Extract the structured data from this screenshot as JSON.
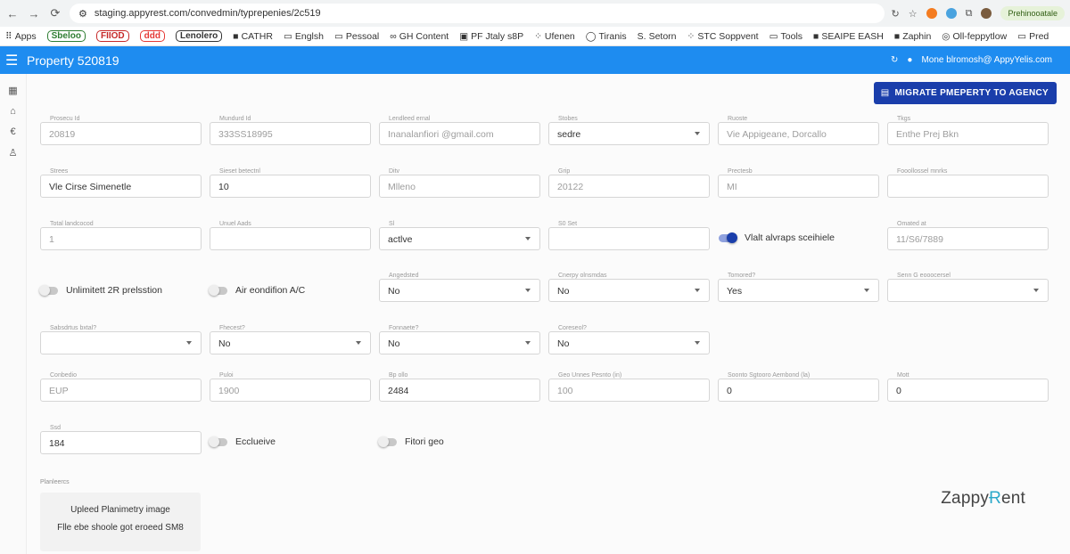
{
  "browser": {
    "url": "staging.appyrest.com/convedmin/typrepenies/2c519",
    "profile": "Prehinooatale",
    "bookmarks": [
      {
        "label": "Apps",
        "icon": "apps-grid-icon"
      },
      {
        "label": "Sbeloo",
        "chip": "#2e7d32"
      },
      {
        "label": "FIIOD",
        "chip": "#c62828"
      },
      {
        "label": "ddd",
        "chip": "#e53935"
      },
      {
        "label": "Lenolero",
        "chip": "#333333"
      },
      {
        "label": "CATHR",
        "icon": "square-icon"
      },
      {
        "label": "Englsh",
        "icon": "folder-icon"
      },
      {
        "label": "Pessoal",
        "icon": "folder-icon"
      },
      {
        "label": "GH Content",
        "icon": "link-icon"
      },
      {
        "label": "PF Jtaly s8P",
        "icon": "doc-icon"
      },
      {
        "label": "Ufenen",
        "icon": "dots-icon"
      },
      {
        "label": "Tiranis",
        "icon": "circle-icon"
      },
      {
        "label": "Setorn",
        "icon": "s-icon"
      },
      {
        "label": "STC Soppvent",
        "icon": "dots-icon"
      },
      {
        "label": "Tools",
        "icon": "folder-icon"
      },
      {
        "label": "SEAIPE EASH",
        "icon": "square-icon"
      },
      {
        "label": "Zaphin",
        "icon": "square-icon"
      },
      {
        "label": "Oll-feppytlow",
        "icon": "globe-icon"
      },
      {
        "label": "Pred",
        "icon": "folder-icon"
      }
    ]
  },
  "app": {
    "title": "Property 520819",
    "user": "Mone blromosh@ AppyYelis.com",
    "migrate_label": "MIGRATE PMEPERTY TO AGENCY"
  },
  "fields": [
    {
      "label": "Prosecu Id",
      "value": "20819",
      "muted": true
    },
    {
      "label": "Mundurd Id",
      "value": "333SS18995",
      "muted": true
    },
    {
      "label": "Lendleed ernal",
      "value": "Inanalanfiori @gmail.com",
      "muted": true
    },
    {
      "label": "Stobes",
      "value": "sedre",
      "select": true
    },
    {
      "label": "Ruoste",
      "value": "Vie Appigeane, Dorcallo",
      "muted": true
    },
    {
      "label": "Tkgs",
      "value": "Enthe Prej Bkn",
      "muted": true
    },
    {
      "label": "Strees",
      "value": "Vle Cirse Simenetle"
    },
    {
      "label": "Sieset betectnl",
      "value": "10"
    },
    {
      "label": "Ditv",
      "value": "Mlleno",
      "muted": true
    },
    {
      "label": "Grip",
      "value": "20122",
      "muted": true
    },
    {
      "label": "Prectesb",
      "value": "MI",
      "muted": true
    },
    {
      "label": "Fooollossel mnrks",
      "value": ""
    },
    {
      "label": "Total landcocod",
      "value": "1",
      "muted": true
    },
    {
      "label": "Unuel Aads",
      "value": ""
    },
    {
      "label": "Sl",
      "value": "actlve",
      "select": true
    },
    {
      "label": "S0 Set",
      "value": ""
    },
    {
      "label": "Omated at",
      "value": "11/S6/7889",
      "muted": true
    },
    {
      "label": "Angedsted",
      "value": "No",
      "select": true
    },
    {
      "label": "Cnerpy olnsmdas",
      "value": "No",
      "select": true
    },
    {
      "label": "Tomored?",
      "value": "Yes",
      "select": true
    },
    {
      "label": "Senn G eooocersel",
      "value": "",
      "select": true
    },
    {
      "label": "Sabsdrtus bxtal?",
      "value": "",
      "select": true
    },
    {
      "label": "Fhecest?",
      "value": "No",
      "select": true
    },
    {
      "label": "Fonnaete?",
      "value": "No",
      "select": true
    },
    {
      "label": "Coreseol?",
      "value": "No",
      "select": true
    },
    {
      "label": "Conbedio",
      "value": "EUP",
      "muted": true
    },
    {
      "label": "Puloi",
      "value": "1900",
      "muted": true
    },
    {
      "label": "Bp ollo",
      "value": "2484"
    },
    {
      "label": "Geo Unnes Pesnto (in)",
      "value": "100",
      "muted": true
    },
    {
      "label": "Soonto Sgtooro Aembond (la)",
      "value": "0"
    },
    {
      "label": "Mott",
      "value": "0"
    },
    {
      "label": "Ssd",
      "value": "184"
    }
  ],
  "toggles": [
    {
      "label": "Vlalt alvraps sceihiele",
      "on": true
    },
    {
      "label": "Unlimitett 2R prelsstion",
      "on": false
    },
    {
      "label": "Air eondifion A/C",
      "on": false
    },
    {
      "label": "Ecclueive",
      "on": false
    },
    {
      "label": "Fitori geo",
      "on": false
    }
  ],
  "planimetry": {
    "title": "Planleercs",
    "upload_title": "Upleed Planimetry image",
    "upload_note": "Flle ebe shoole got eroeed SM8"
  },
  "brand": {
    "left": "Zappy",
    "right": "ent"
  }
}
